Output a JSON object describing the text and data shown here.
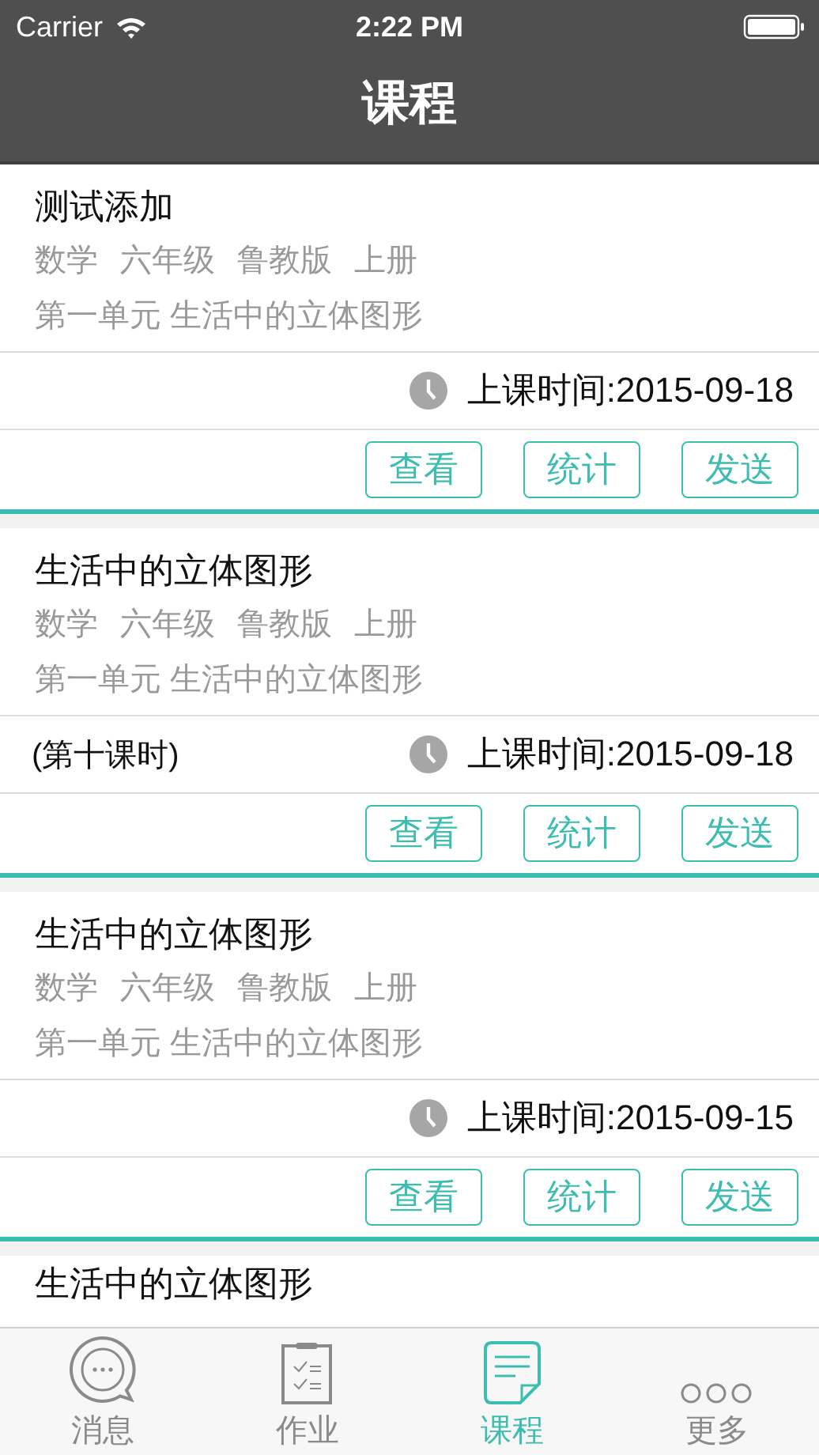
{
  "status_bar": {
    "carrier": "Carrier",
    "time": "2:22 PM"
  },
  "nav": {
    "title": "课程"
  },
  "courses": [
    {
      "title": "测试添加",
      "tags": [
        "数学",
        "六年级",
        "鲁教版",
        "上册"
      ],
      "unit": "第一单元 生活中的立体图形",
      "time": "上课时间:2015-09-18",
      "actions": [
        "查看",
        "统计",
        "发送"
      ]
    },
    {
      "title": "生活中的立体图形",
      "tags": [
        "数学",
        "六年级",
        "鲁教版",
        "上册"
      ],
      "unit": "第一单元 生活中的立体图形",
      "lesson": "(第十课时)",
      "time": "上课时间:2015-09-18",
      "actions": [
        "查看",
        "统计",
        "发送"
      ]
    },
    {
      "title": "生活中的立体图形",
      "tags": [
        "数学",
        "六年级",
        "鲁教版",
        "上册"
      ],
      "unit": "第一单元 生活中的立体图形",
      "time": "上课时间:2015-09-15",
      "actions": [
        "查看",
        "统计",
        "发送"
      ]
    },
    {
      "title": "生活中的立体图形"
    }
  ],
  "tab_bar": [
    {
      "kind": "messages",
      "label": "消息",
      "selected": false
    },
    {
      "kind": "homework",
      "label": "作业",
      "selected": false
    },
    {
      "kind": "courses",
      "label": "课程",
      "selected": true
    },
    {
      "kind": "more",
      "label": "更多",
      "selected": false
    }
  ]
}
